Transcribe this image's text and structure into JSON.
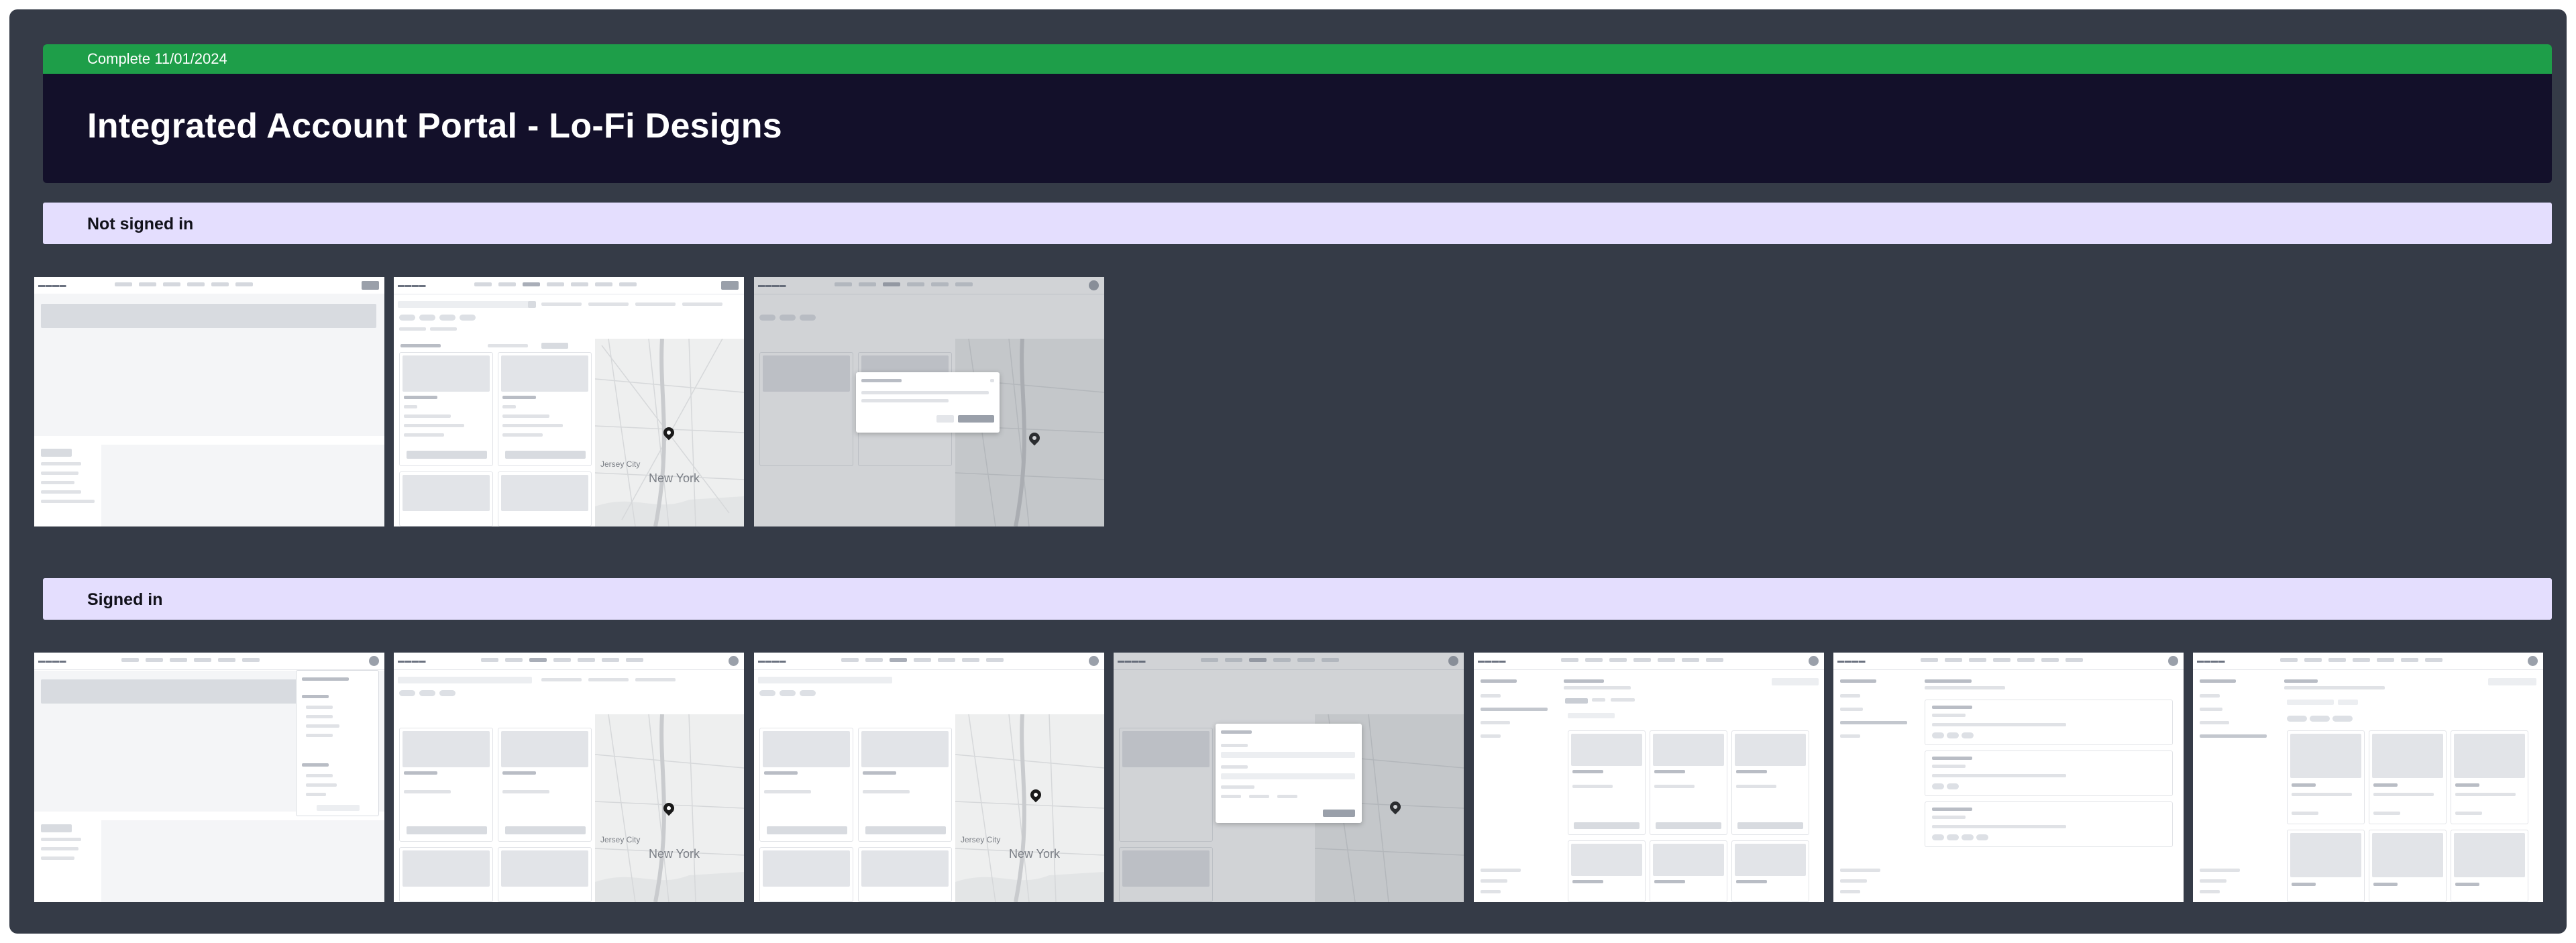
{
  "banner": {
    "status": "Complete 11/01/2024",
    "title": "Integrated Account Portal - Lo-Fi Designs",
    "status_color": "#1e9e49",
    "background_color": "#13102a"
  },
  "sections": [
    {
      "label": "Not signed in"
    },
    {
      "label": "Signed in"
    }
  ],
  "colors": {
    "board": "#353b47",
    "section_bar": "#e4defe"
  }
}
